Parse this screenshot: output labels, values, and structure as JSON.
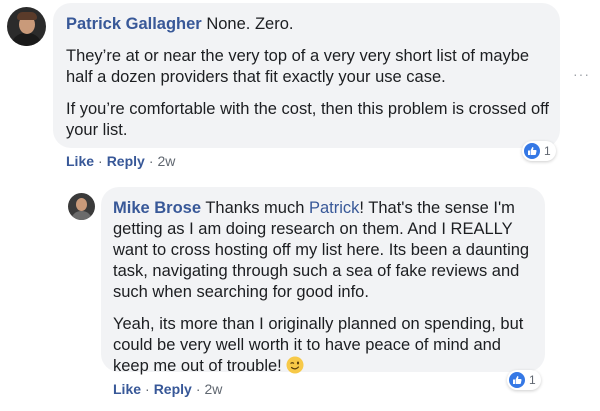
{
  "comments": [
    {
      "author": "Patrick Gallagher",
      "paragraphs": [
        "None. Zero.",
        "They’re at or near the very top of a very very short list of maybe half a dozen providers that fit exactly your use case.",
        "If you’re comfortable with the cost, then this problem is crossed off your list."
      ],
      "actions": {
        "like": "Like",
        "reply": "Reply",
        "age": "2w"
      },
      "reaction_count": "1"
    },
    {
      "author": "Mike Brose",
      "text_before_mention": "Thanks much ",
      "mention": "Patrick",
      "text_after_mention": "! That's the sense I'm getting as I am doing research on them. And I REALLY want to cross hosting off my list here. Its been a daunting task, navigating through such a sea of fake reviews and such when searching for good info.",
      "paragraph2": "Yeah, its more than I originally planned on spending, but could be very well worth it to have peace of mind and keep me out of trouble! ",
      "emoji": "wink-emoji",
      "actions": {
        "like": "Like",
        "reply": "Reply",
        "age": "2w"
      },
      "reaction_count": "1"
    }
  ],
  "more_options": "···",
  "separator": "·",
  "colors": {
    "link": "#385898",
    "bubble": "#f2f3f5",
    "like": "#3578e5"
  }
}
